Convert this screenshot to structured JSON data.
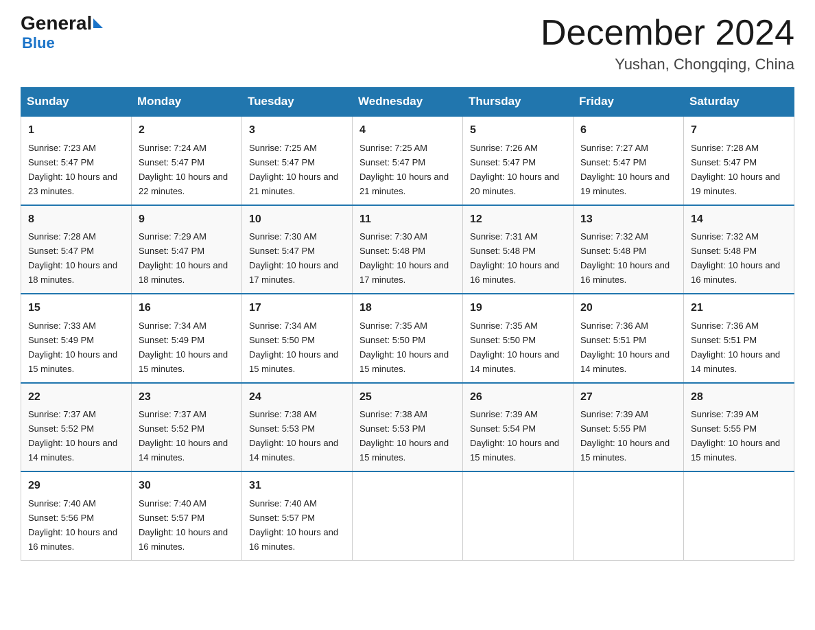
{
  "logo": {
    "general": "General",
    "blue": "Blue"
  },
  "header": {
    "month": "December 2024",
    "location": "Yushan, Chongqing, China"
  },
  "weekdays": [
    "Sunday",
    "Monday",
    "Tuesday",
    "Wednesday",
    "Thursday",
    "Friday",
    "Saturday"
  ],
  "weeks": [
    [
      {
        "day": 1,
        "sunrise": "7:23 AM",
        "sunset": "5:47 PM",
        "daylight": "10 hours and 23 minutes."
      },
      {
        "day": 2,
        "sunrise": "7:24 AM",
        "sunset": "5:47 PM",
        "daylight": "10 hours and 22 minutes."
      },
      {
        "day": 3,
        "sunrise": "7:25 AM",
        "sunset": "5:47 PM",
        "daylight": "10 hours and 21 minutes."
      },
      {
        "day": 4,
        "sunrise": "7:25 AM",
        "sunset": "5:47 PM",
        "daylight": "10 hours and 21 minutes."
      },
      {
        "day": 5,
        "sunrise": "7:26 AM",
        "sunset": "5:47 PM",
        "daylight": "10 hours and 20 minutes."
      },
      {
        "day": 6,
        "sunrise": "7:27 AM",
        "sunset": "5:47 PM",
        "daylight": "10 hours and 19 minutes."
      },
      {
        "day": 7,
        "sunrise": "7:28 AM",
        "sunset": "5:47 PM",
        "daylight": "10 hours and 19 minutes."
      }
    ],
    [
      {
        "day": 8,
        "sunrise": "7:28 AM",
        "sunset": "5:47 PM",
        "daylight": "10 hours and 18 minutes."
      },
      {
        "day": 9,
        "sunrise": "7:29 AM",
        "sunset": "5:47 PM",
        "daylight": "10 hours and 18 minutes."
      },
      {
        "day": 10,
        "sunrise": "7:30 AM",
        "sunset": "5:47 PM",
        "daylight": "10 hours and 17 minutes."
      },
      {
        "day": 11,
        "sunrise": "7:30 AM",
        "sunset": "5:48 PM",
        "daylight": "10 hours and 17 minutes."
      },
      {
        "day": 12,
        "sunrise": "7:31 AM",
        "sunset": "5:48 PM",
        "daylight": "10 hours and 16 minutes."
      },
      {
        "day": 13,
        "sunrise": "7:32 AM",
        "sunset": "5:48 PM",
        "daylight": "10 hours and 16 minutes."
      },
      {
        "day": 14,
        "sunrise": "7:32 AM",
        "sunset": "5:48 PM",
        "daylight": "10 hours and 16 minutes."
      }
    ],
    [
      {
        "day": 15,
        "sunrise": "7:33 AM",
        "sunset": "5:49 PM",
        "daylight": "10 hours and 15 minutes."
      },
      {
        "day": 16,
        "sunrise": "7:34 AM",
        "sunset": "5:49 PM",
        "daylight": "10 hours and 15 minutes."
      },
      {
        "day": 17,
        "sunrise": "7:34 AM",
        "sunset": "5:50 PM",
        "daylight": "10 hours and 15 minutes."
      },
      {
        "day": 18,
        "sunrise": "7:35 AM",
        "sunset": "5:50 PM",
        "daylight": "10 hours and 15 minutes."
      },
      {
        "day": 19,
        "sunrise": "7:35 AM",
        "sunset": "5:50 PM",
        "daylight": "10 hours and 14 minutes."
      },
      {
        "day": 20,
        "sunrise": "7:36 AM",
        "sunset": "5:51 PM",
        "daylight": "10 hours and 14 minutes."
      },
      {
        "day": 21,
        "sunrise": "7:36 AM",
        "sunset": "5:51 PM",
        "daylight": "10 hours and 14 minutes."
      }
    ],
    [
      {
        "day": 22,
        "sunrise": "7:37 AM",
        "sunset": "5:52 PM",
        "daylight": "10 hours and 14 minutes."
      },
      {
        "day": 23,
        "sunrise": "7:37 AM",
        "sunset": "5:52 PM",
        "daylight": "10 hours and 14 minutes."
      },
      {
        "day": 24,
        "sunrise": "7:38 AM",
        "sunset": "5:53 PM",
        "daylight": "10 hours and 14 minutes."
      },
      {
        "day": 25,
        "sunrise": "7:38 AM",
        "sunset": "5:53 PM",
        "daylight": "10 hours and 15 minutes."
      },
      {
        "day": 26,
        "sunrise": "7:39 AM",
        "sunset": "5:54 PM",
        "daylight": "10 hours and 15 minutes."
      },
      {
        "day": 27,
        "sunrise": "7:39 AM",
        "sunset": "5:55 PM",
        "daylight": "10 hours and 15 minutes."
      },
      {
        "day": 28,
        "sunrise": "7:39 AM",
        "sunset": "5:55 PM",
        "daylight": "10 hours and 15 minutes."
      }
    ],
    [
      {
        "day": 29,
        "sunrise": "7:40 AM",
        "sunset": "5:56 PM",
        "daylight": "10 hours and 16 minutes."
      },
      {
        "day": 30,
        "sunrise": "7:40 AM",
        "sunset": "5:57 PM",
        "daylight": "10 hours and 16 minutes."
      },
      {
        "day": 31,
        "sunrise": "7:40 AM",
        "sunset": "5:57 PM",
        "daylight": "10 hours and 16 minutes."
      },
      null,
      null,
      null,
      null
    ]
  ]
}
